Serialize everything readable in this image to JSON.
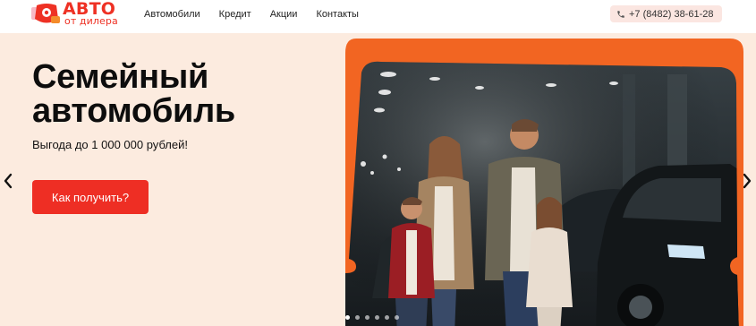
{
  "brand": {
    "main": "АВТО",
    "sub": "от дилера",
    "color": "#ee3124"
  },
  "nav": [
    {
      "label": "Автомобили"
    },
    {
      "label": "Кредит"
    },
    {
      "label": "Акции"
    },
    {
      "label": "Контакты"
    }
  ],
  "phone": {
    "number": "+7 (8482) 38-61-28",
    "icon": "phone-icon"
  },
  "hero": {
    "title_line1": "Семейный",
    "title_line2": "автомобиль",
    "subtitle": "Выгода до 1 000 000 рублей!",
    "cta_label": "Как получить?",
    "accent": "#f26522",
    "background": "#fcebdf"
  },
  "carousel": {
    "slides": 6,
    "active_index": 0
  }
}
